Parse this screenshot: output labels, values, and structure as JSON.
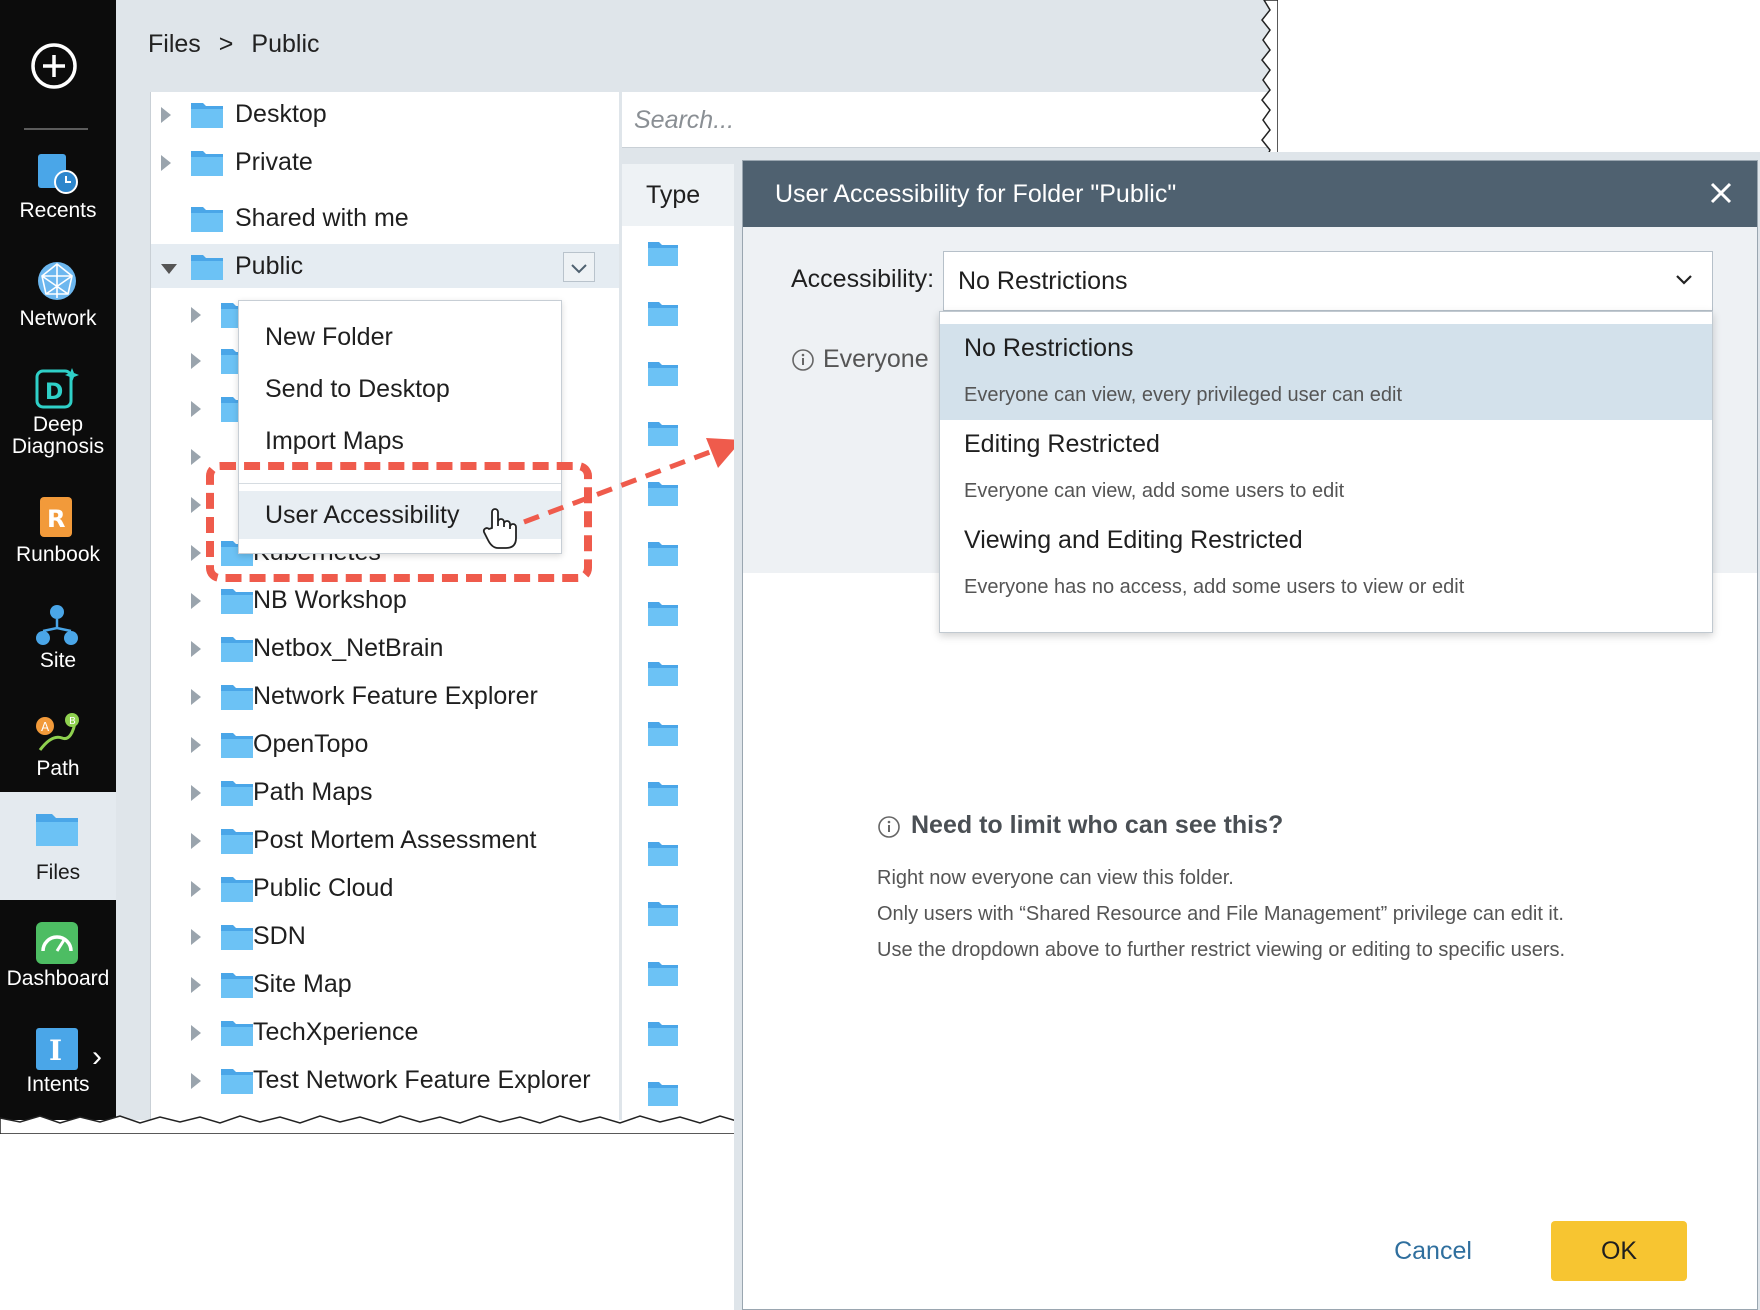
{
  "nav": {
    "items": [
      {
        "label": "Recents",
        "icon": "recents-icon"
      },
      {
        "label": "Network",
        "icon": "network-icon"
      },
      {
        "label": "Deep Diagnosis",
        "icon": "deep-diagnosis-icon"
      },
      {
        "label": "Runbook",
        "icon": "runbook-icon"
      },
      {
        "label": "Site",
        "icon": "site-icon"
      },
      {
        "label": "Path",
        "icon": "path-icon"
      },
      {
        "label": "Files",
        "icon": "files-icon",
        "active": true
      },
      {
        "label": "Dashboard",
        "icon": "dashboard-icon"
      },
      {
        "label": "Intents",
        "icon": "intents-icon"
      }
    ]
  },
  "breadcrumb": {
    "root": "Files",
    "sep": ">",
    "current": "Public"
  },
  "search": {
    "placeholder": "Search..."
  },
  "tree": {
    "top": [
      {
        "label": "Desktop"
      },
      {
        "label": "Private"
      },
      {
        "label": "Shared with me"
      },
      {
        "label": "Public"
      }
    ],
    "children": [
      "Kubernetes",
      "NB Workshop",
      "Netbox_NetBrain",
      "Network Feature Explorer",
      "OpenTopo",
      "Path Maps",
      "Post Mortem Assessment",
      "Public Cloud",
      "SDN",
      "Site Map",
      "TechXperience",
      "Test Network Feature Explorer"
    ]
  },
  "column": {
    "type_header": "Type"
  },
  "context_menu": {
    "items": [
      "New Folder",
      "Send to Desktop",
      "Import Maps",
      "User Accessibility"
    ]
  },
  "dialog": {
    "title": "User Accessibility for Folder \"Public\"",
    "accessibility_label": "Accessibility:",
    "selected": "No Restrictions",
    "everyone_text": "Everyone",
    "options": [
      {
        "title": "No Restrictions",
        "desc": "Everyone can view, every privileged user can edit"
      },
      {
        "title": "Editing Restricted",
        "desc": "Everyone can view, add some users to edit"
      },
      {
        "title": "Viewing and Editing Restricted",
        "desc": "Everyone has no access, add some users to view or edit"
      }
    ],
    "info_title": "Need to limit who can see this?",
    "info_lines": [
      "Right now everyone can view this folder.",
      "Only users with “Shared Resource and File Management” privilege can edit it.",
      "Use the dropdown above to further restrict viewing or editing to specific users."
    ],
    "cancel": "Cancel",
    "ok": "OK"
  },
  "colors": {
    "ok_button": "#f7c531",
    "header": "#4f6170",
    "highlight": "#ef5b4c",
    "folder": "#5bbcf3"
  }
}
